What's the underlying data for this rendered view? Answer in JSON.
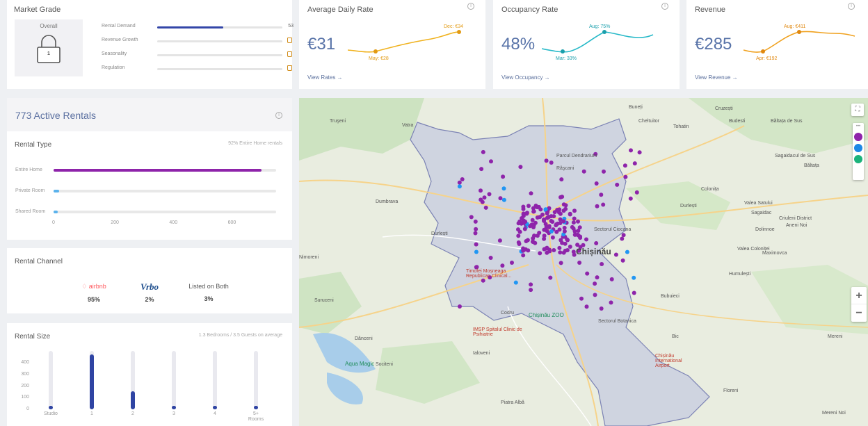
{
  "market_grade": {
    "title": "Market Grade",
    "overall_label": "Overall",
    "lock_value": "1",
    "rows": [
      {
        "label": "Rental Demand",
        "value": "53",
        "fill": 0.53,
        "locked": false
      },
      {
        "label": "Revenue Growth",
        "value": "",
        "fill": 0,
        "locked": true
      },
      {
        "label": "Seasonality",
        "value": "",
        "fill": 0,
        "locked": true
      },
      {
        "label": "Regulation",
        "value": "",
        "fill": 0,
        "locked": true
      }
    ]
  },
  "metrics": [
    {
      "title": "Average Daily Rate",
      "value": "€31",
      "peak": "Dec: €34",
      "low": "May: €28",
      "link": "View Rates →",
      "color": "#f0b21e",
      "dot": "#e29a12"
    },
    {
      "title": "Occupancy Rate",
      "value": "48%",
      "peak": "Aug: 75%",
      "low": "Mar: 33%",
      "link": "View Occupancy →",
      "color": "#27b9c8",
      "dot": "#1a9fac"
    },
    {
      "title": "Revenue",
      "value": "€285",
      "peak": "Aug: €411",
      "low": "Apr: €192",
      "link": "View Revenue →",
      "color": "#f0a11e",
      "dot": "#e0880f"
    }
  ],
  "active_rentals": {
    "title": "773 Active Rentals"
  },
  "rental_type": {
    "title": "Rental Type",
    "summary": "92% Entire Home rentals",
    "rows": [
      {
        "label": "Entire Home",
        "value": 710,
        "color": "#8e24aa"
      },
      {
        "label": "Private Room",
        "value": 20,
        "color": "#5ab2ec"
      },
      {
        "label": "Shared Room",
        "value": 2,
        "color": "#5ab2ec"
      }
    ],
    "ticks": [
      "0",
      "200",
      "400",
      "600"
    ],
    "max": 760
  },
  "rental_channel": {
    "title": "Rental Channel",
    "airbnb_label": "airbnb",
    "airbnb_pct": "95%",
    "vrbo_label": "Vrbo",
    "vrbo_pct": "2%",
    "both_label": "Listed on Both",
    "both_pct": "3%"
  },
  "rental_size": {
    "title": "Rental Size",
    "summary": "1.3 Bedrooms / 3.5 Guests on average",
    "y_ticks": [
      "400",
      "300",
      "200",
      "100",
      "0"
    ],
    "max": 480,
    "bars": [
      {
        "label": "Studio",
        "value": 5
      },
      {
        "label": "1",
        "value": 475
      },
      {
        "label": "2",
        "value": 155
      },
      {
        "label": "3",
        "value": 20
      },
      {
        "label": "4",
        "value": 3
      },
      {
        "label": "5+ Rooms",
        "value": 3
      }
    ]
  },
  "map": {
    "city": "Chișinău",
    "places": [
      {
        "name": "Truşeni",
        "big": false
      },
      {
        "name": "Vatra",
        "big": false
      },
      {
        "name": "Dumbrava",
        "big": false
      },
      {
        "name": "Durlești",
        "big": false
      },
      {
        "name": "Nimoreni",
        "big": false
      },
      {
        "name": "Suruceni",
        "big": false
      },
      {
        "name": "Dănceni",
        "big": false
      },
      {
        "name": "Ialoveni",
        "big": false
      },
      {
        "name": "Sociteni",
        "big": false
      },
      {
        "name": "Codru",
        "big": false
      },
      {
        "name": "Piatra Albă",
        "big": false
      },
      {
        "name": "Buneți",
        "big": false
      },
      {
        "name": "Cruzești",
        "big": false
      },
      {
        "name": "Cheltuitor",
        "big": false
      },
      {
        "name": "Tohatin",
        "big": false
      },
      {
        "name": "Budesti",
        "big": false
      },
      {
        "name": "Băltața de Sus",
        "big": false
      },
      {
        "name": "Sagaidacul de Sus",
        "big": false
      },
      {
        "name": "Băltața",
        "big": false
      },
      {
        "name": "Colonița",
        "big": false
      },
      {
        "name": "Durlești",
        "big": false
      },
      {
        "name": "Valea Satului",
        "big": false
      },
      {
        "name": "Sagaidac",
        "big": false
      },
      {
        "name": "Dolinnoe",
        "big": false
      },
      {
        "name": "Valea Coloniței",
        "big": false
      },
      {
        "name": "Maximovca",
        "big": false
      },
      {
        "name": "Humulești",
        "big": false
      },
      {
        "name": "Bubuieci",
        "big": false
      },
      {
        "name": "Bic",
        "big": false
      },
      {
        "name": "Mereni",
        "big": false
      },
      {
        "name": "Floreni",
        "big": false
      },
      {
        "name": "Mereni Noi",
        "big": false
      },
      {
        "name": "Parcul Dendrarium",
        "big": false
      },
      {
        "name": "Râşcani",
        "big": false
      },
      {
        "name": "Sectorul Ciocana",
        "big": false
      },
      {
        "name": "Sectorul Botanica",
        "big": false
      },
      {
        "name": "Criuleni District",
        "big": false
      },
      {
        "name": "Aneni Noi",
        "big": false
      }
    ],
    "pois": [
      {
        "name": "Timofei Moșneaga Republican Clinical...",
        "type": "hospital"
      },
      {
        "name": "IMSP Spitalul Clinic de Psihiatrie",
        "type": "hospital"
      },
      {
        "name": "Chișinău ZOO",
        "type": "zoo"
      },
      {
        "name": "Aqua Magic",
        "type": "park"
      },
      {
        "name": "Chișinău International Airport",
        "type": "airport"
      }
    ],
    "zoom_in": "+",
    "zoom_out": "−",
    "fullscreen": "⛶",
    "more": "•••"
  }
}
